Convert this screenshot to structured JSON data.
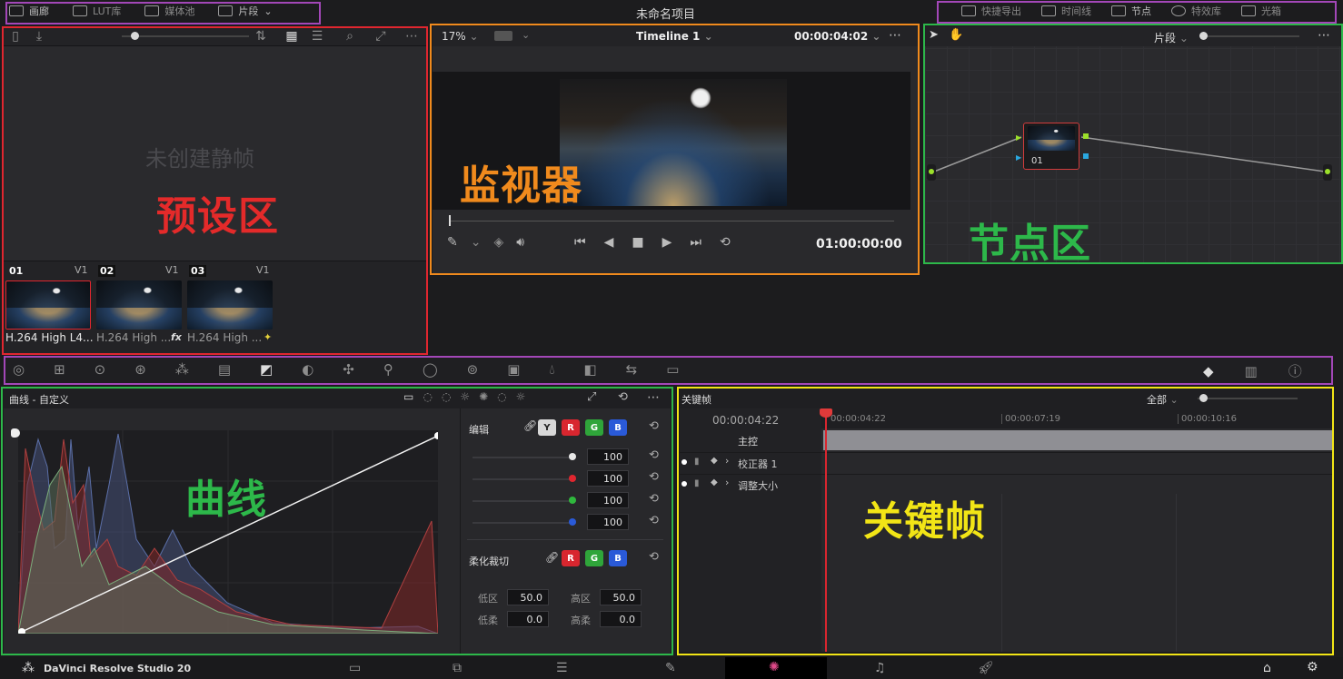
{
  "project_title": "未命名项目",
  "topbar_left": [
    {
      "label": "画廊",
      "icon": "gallery-icon"
    },
    {
      "label": "LUT库",
      "icon": "lut-icon"
    },
    {
      "label": "媒体池",
      "icon": "media-pool-icon"
    },
    {
      "label": "片段",
      "icon": "clips-icon"
    }
  ],
  "topbar_right": [
    {
      "label": "快捷导出",
      "icon": "export-icon"
    },
    {
      "label": "时间线",
      "icon": "timeline-icon"
    },
    {
      "label": "节点",
      "icon": "nodes-icon"
    },
    {
      "label": "特效库",
      "icon": "fx-icon"
    },
    {
      "label": "光箱",
      "icon": "lightbox-icon"
    }
  ],
  "gallery": {
    "empty_text": "未创建静帧",
    "annotation": "预设区",
    "clips": [
      {
        "num": "01",
        "track": "V1",
        "name": "H.264 High L4...",
        "badge": ""
      },
      {
        "num": "02",
        "track": "V1",
        "name": "H.264 High ...",
        "badge": "fx"
      },
      {
        "num": "03",
        "track": "V1",
        "name": "H.264 High ...",
        "badge": "✦"
      }
    ]
  },
  "viewer": {
    "zoom": "17%",
    "timeline_name": "Timeline 1",
    "duration": "00:00:04:02",
    "timecode": "01:00:00:00",
    "annotation": "监视器"
  },
  "nodes": {
    "dropdown": "片段",
    "node_label": "01",
    "annotation": "节点区"
  },
  "curves": {
    "title": "曲线 - 自定义",
    "edit_label": "编辑",
    "channels": [
      "Y",
      "R",
      "G",
      "B"
    ],
    "values": [
      "100",
      "100",
      "100",
      "100"
    ],
    "soft_clip_label": "柔化裁切",
    "low_label": "低区",
    "low_value": "50.0",
    "high_label": "高区",
    "high_value": "50.0",
    "low_soft_label": "低柔",
    "low_soft_value": "0.0",
    "high_soft_label": "高柔",
    "high_soft_value": "0.0",
    "annotation": "曲线"
  },
  "keyframes": {
    "title": "关键帧",
    "filter": "全部",
    "current_time": "00:00:04:22",
    "ruler": [
      "00:00:04:22",
      "00:00:07:19",
      "00:00:10:16"
    ],
    "tracks": [
      "主控",
      "校正器 1",
      "调整大小"
    ],
    "annotation": "关键帧"
  },
  "app_name": "DaVinci Resolve Studio 20",
  "colors": {
    "red_box": "#e0262f",
    "orange_box": "#f08a1d",
    "green_box": "#2db84a",
    "yellow_box": "#f2e516",
    "purple_box": "#a347b8"
  }
}
